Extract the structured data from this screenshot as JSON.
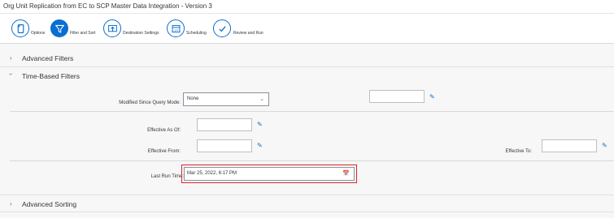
{
  "window": {
    "title": "Org Unit Replication from EC to SCP Master Data Integration - Version 3"
  },
  "steps": [
    {
      "label": "Options",
      "icon": "document-icon",
      "active": false
    },
    {
      "label": "Filter and Sort",
      "icon": "filter-icon",
      "active": true
    },
    {
      "label": "Destination Settings",
      "icon": "destination-icon",
      "active": false
    },
    {
      "label": "Scheduling",
      "icon": "calendar-icon",
      "active": false
    },
    {
      "label": "Review and Run",
      "icon": "checkmark-icon",
      "active": false
    }
  ],
  "sections": {
    "advanced_filters": "Advanced Filters",
    "time_based_filters": "Time-Based Filters",
    "advanced_sorting": "Advanced Sorting"
  },
  "fields": {
    "modified_since_mode_label": "Modified Since Query Mode:",
    "modified_since_mode_value": "None",
    "effective_as_of_label": "Effective As Of:",
    "effective_from_label": "Effective From:",
    "effective_to_label": "Effective To:",
    "last_run_time_label": "Last Run Time:",
    "last_run_time_value": "Mar 25, 2022, 6:17 PM"
  },
  "colors": {
    "accent": "#0a6ed1",
    "highlight": "#d9262c"
  }
}
